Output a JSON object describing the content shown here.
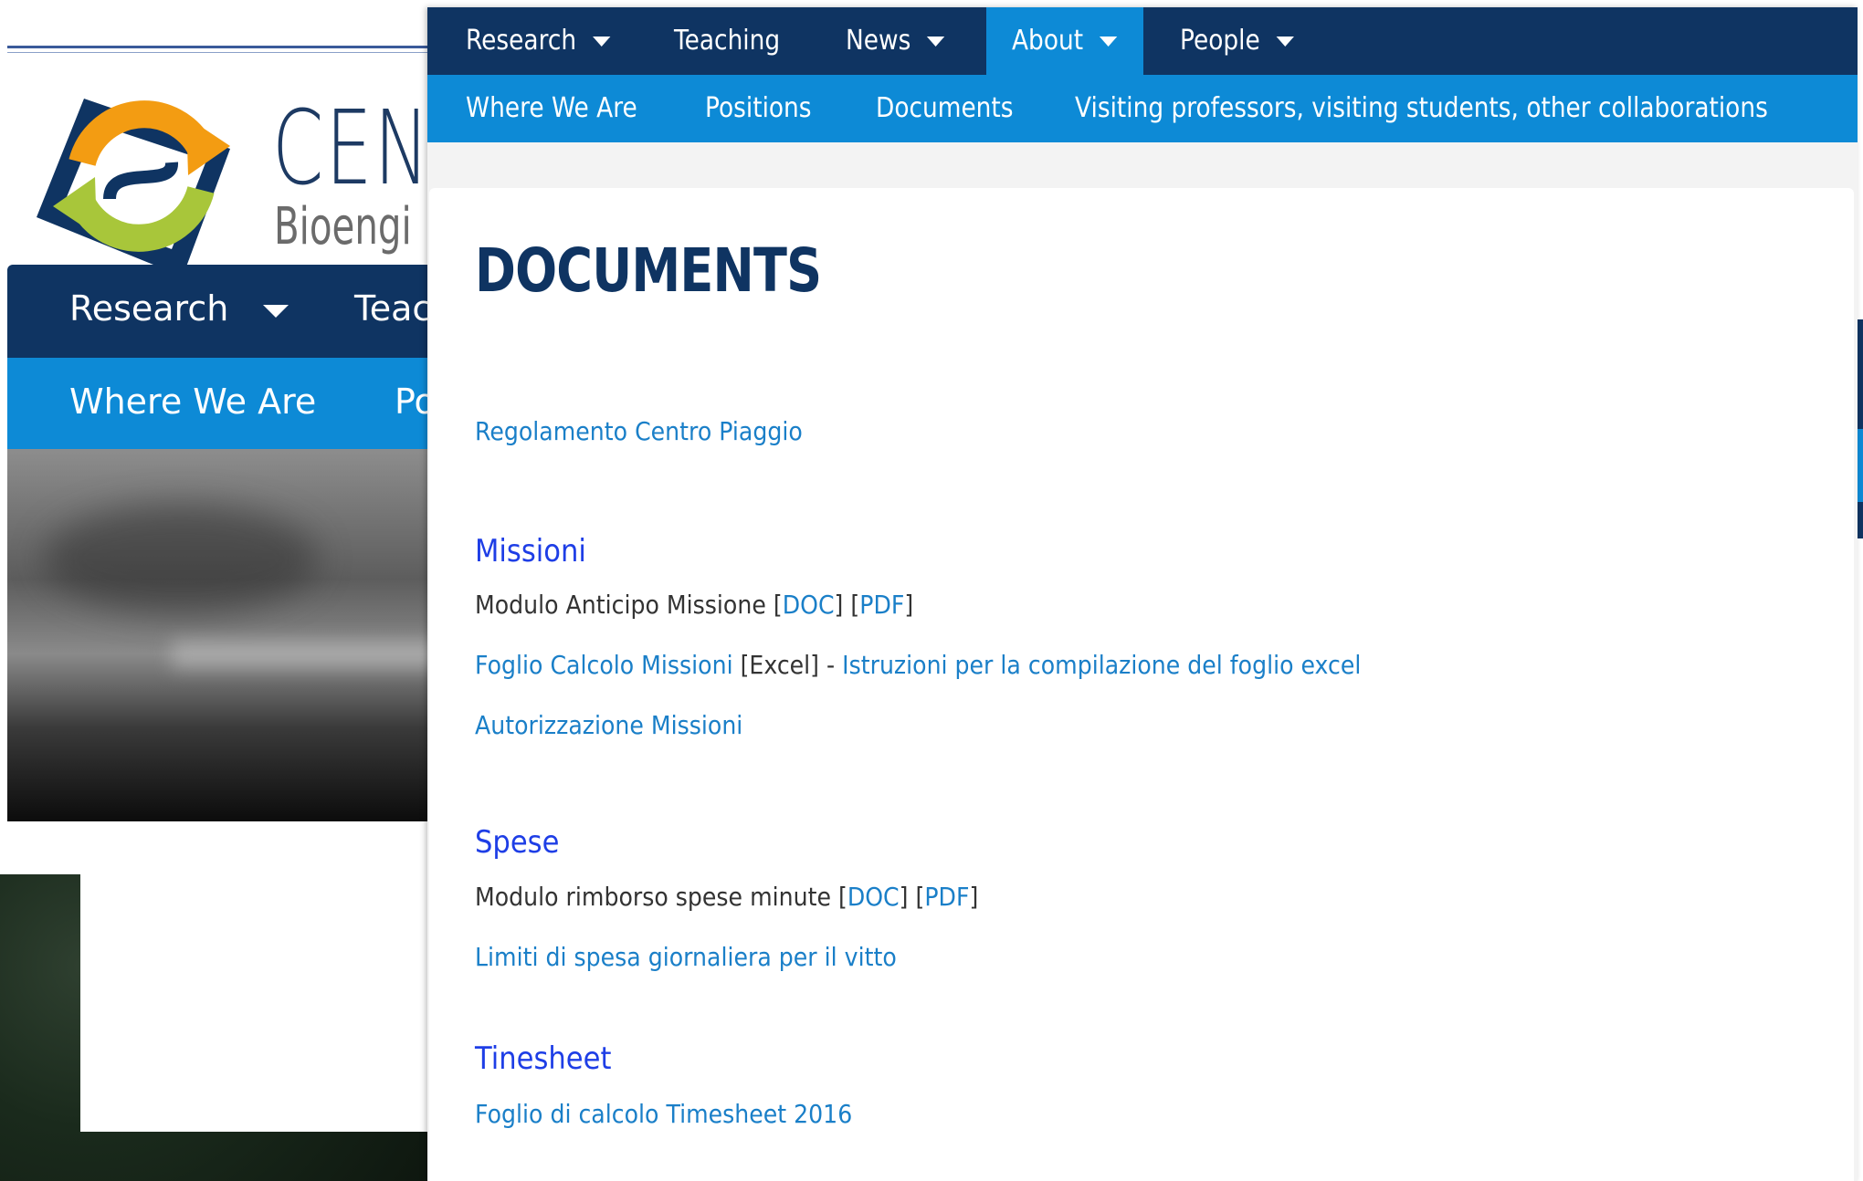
{
  "background_window": {
    "logo_title": "CEN",
    "logo_subtitle": "Bioengi",
    "nav_primary": [
      "Research",
      "Teac"
    ],
    "nav_secondary": [
      "Where We Are",
      "Po"
    ]
  },
  "main_nav": {
    "items": [
      {
        "label": "Research",
        "dropdown": true
      },
      {
        "label": "Teaching",
        "dropdown": false
      },
      {
        "label": "News",
        "dropdown": true
      },
      {
        "label": "About",
        "dropdown": true,
        "active": true
      },
      {
        "label": "People",
        "dropdown": true
      }
    ]
  },
  "sub_nav": {
    "items": [
      "Where We Are",
      "Positions",
      "Documents",
      "Visiting professors, visiting students, other collaborations"
    ]
  },
  "page": {
    "title": "DOCUMENTS",
    "regolamento": "Regolamento Centro Piaggio",
    "missioni": {
      "heading": "Missioni",
      "anticipo_text": "Modulo Anticipo Missione",
      "doc": "DOC",
      "pdf": "PDF",
      "foglio_calcolo": "Foglio Calcolo Missioni",
      "excel": "[Excel]",
      "dash": " - ",
      "istruzioni": "Istruzioni per la compilazione del foglio excel",
      "autorizzazione": "Autorizzazione Missioni"
    },
    "spese": {
      "heading": "Spese",
      "rimborso_text": "Modulo rimborso spese minute",
      "doc": "DOC",
      "pdf": "PDF",
      "limiti": "Limiti di spesa giornaliera per il vitto"
    },
    "timesheet": {
      "heading": "Tinesheet",
      "foglio": "Foglio di calcolo Timesheet 2016"
    }
  },
  "colors": {
    "nav_dark": "#0f3462",
    "nav_light": "#0d8ad6",
    "link": "#1a7fc8",
    "section_heading": "#1e3ee6",
    "logo_orange": "#f39c12",
    "logo_green": "#a8c63a"
  }
}
